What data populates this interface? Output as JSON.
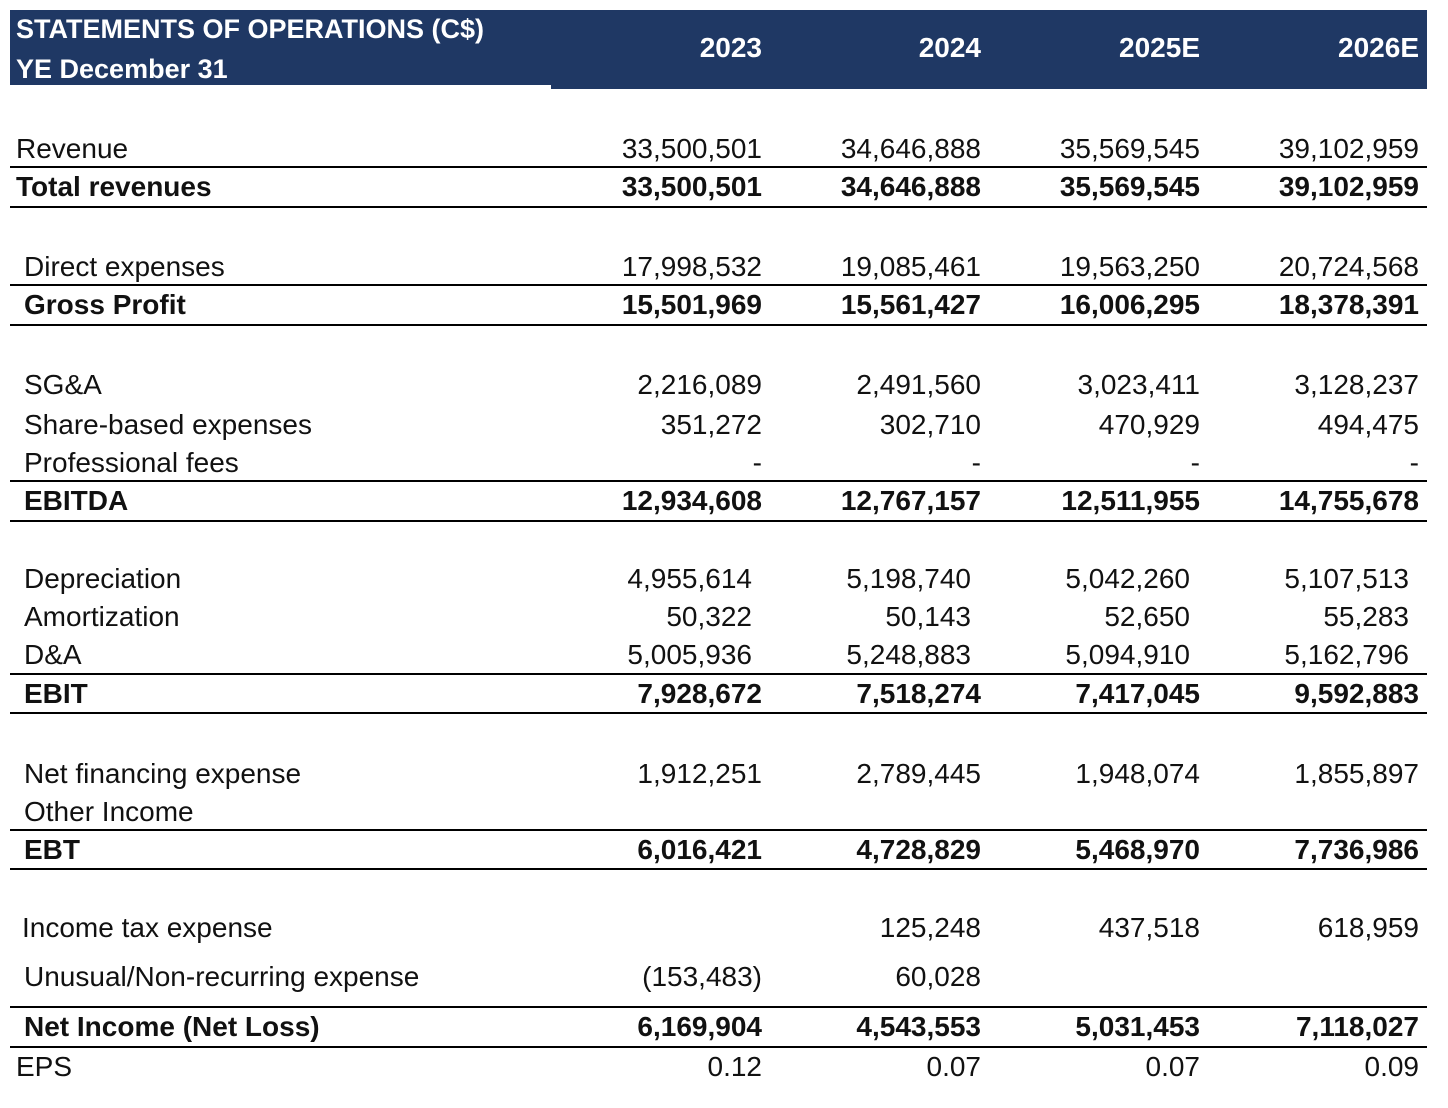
{
  "header": {
    "title_line1": "STATEMENTS OF OPERATIONS (C$)",
    "title_line2": "YE December 31",
    "years": [
      "2023",
      "2024",
      "2025E",
      "2026E"
    ]
  },
  "rows": [
    {
      "label": "Revenue",
      "values": [
        "33,500,501",
        "34,646,888",
        "35,569,545",
        "39,102,959"
      ]
    },
    {
      "label": "Total revenues",
      "values": [
        "33,500,501",
        "34,646,888",
        "35,569,545",
        "39,102,959"
      ]
    },
    {
      "label": "Direct expenses",
      "values": [
        "17,998,532",
        "19,085,461",
        "19,563,250",
        "20,724,568"
      ]
    },
    {
      "label": "Gross Profit",
      "values": [
        "15,501,969",
        "15,561,427",
        "16,006,295",
        "18,378,391"
      ]
    },
    {
      "label": "SG&A",
      "values": [
        "2,216,089",
        "2,491,560",
        "3,023,411",
        "3,128,237"
      ]
    },
    {
      "label": "Share-based expenses",
      "values": [
        "351,272",
        "302,710",
        "470,929",
        "494,475"
      ]
    },
    {
      "label": "Professional fees",
      "values": [
        "-",
        "-",
        "-",
        "-"
      ]
    },
    {
      "label": "EBITDA",
      "values": [
        "12,934,608",
        "12,767,157",
        "12,511,955",
        "14,755,678"
      ]
    },
    {
      "label": "Depreciation",
      "values": [
        "4,955,614",
        "5,198,740",
        "5,042,260",
        "5,107,513"
      ]
    },
    {
      "label": "Amortization",
      "values": [
        "50,322",
        "50,143",
        "52,650",
        "55,283"
      ]
    },
    {
      "label": "D&A",
      "values": [
        "5,005,936",
        "5,248,883",
        "5,094,910",
        "5,162,796"
      ]
    },
    {
      "label": "EBIT",
      "values": [
        "7,928,672",
        "7,518,274",
        "7,417,045",
        "9,592,883"
      ]
    },
    {
      "label": "Net financing expense",
      "values": [
        "1,912,251",
        "2,789,445",
        "1,948,074",
        "1,855,897"
      ]
    },
    {
      "label": "Other Income",
      "values": [
        "",
        "",
        "",
        ""
      ]
    },
    {
      "label": "EBT",
      "values": [
        "6,016,421",
        "4,728,829",
        "5,468,970",
        "7,736,986"
      ]
    },
    {
      "label": "Income tax expense",
      "values": [
        "",
        "125,248",
        "437,518",
        "618,959"
      ]
    },
    {
      "label": "Unusual/Non-recurring expense",
      "values": [
        "(153,483)",
        "60,028",
        "",
        ""
      ]
    },
    {
      "label": "Net Income (Net Loss)",
      "values": [
        "6,169,904",
        "4,543,553",
        "5,031,453",
        "7,118,027"
      ]
    },
    {
      "label": "EPS",
      "values": [
        "0.12",
        "0.07",
        "0.07",
        "0.09"
      ]
    }
  ]
}
